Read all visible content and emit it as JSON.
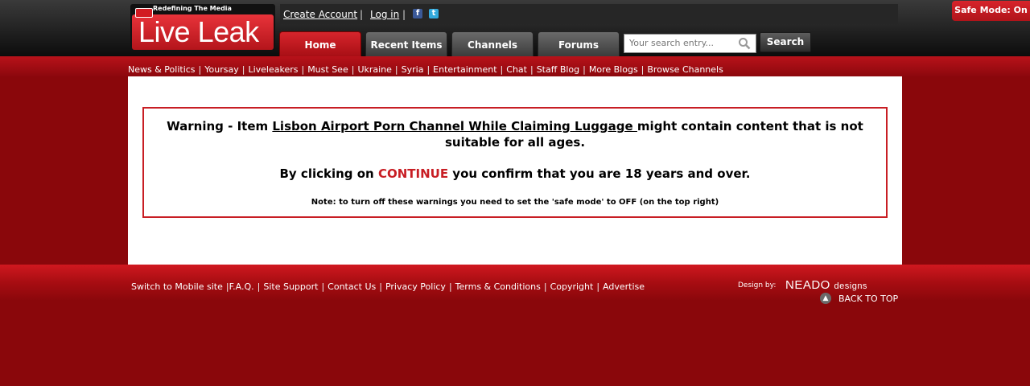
{
  "header": {
    "logo_tagline": "Redefining The Media",
    "logo_word_1": "Live",
    "logo_word_2": "Leak",
    "create_account": "Create Account",
    "log_in": "Log in",
    "separator": "|",
    "tabs": [
      {
        "label": "Home",
        "active": true
      },
      {
        "label": "Recent Items",
        "active": false
      },
      {
        "label": "Channels",
        "active": false
      },
      {
        "label": "Forums",
        "active": false
      }
    ],
    "search": {
      "placeholder": "Your search entry...",
      "button_label": "Search"
    },
    "safe_mode": "Safe Mode: On",
    "icons": [
      "facebook-icon",
      "twitter-icon",
      "search-icon"
    ]
  },
  "subnav": {
    "items": [
      "News & Politics",
      "Yoursay",
      "Liveleakers",
      "Must See",
      "Ukraine",
      "Syria",
      "Entertainment",
      "Chat",
      "Staff Blog",
      "More Blogs",
      "Browse Channels"
    ]
  },
  "warning": {
    "prefix": "Warning - Item ",
    "item_title": "Lisbon Airport Porn Channel While Claiming Luggage ",
    "suffix": "might contain content that is not suitable for all ages.",
    "confirm_prefix": "By clicking on ",
    "continue_label": "CONTINUE",
    "confirm_suffix": " you confirm that you are 18 years and over.",
    "note": "Note: to turn off these warnings you need to set the 'safe mode' to OFF (on the top right)"
  },
  "footer": {
    "links": [
      "Switch to Mobile site",
      "F.A.Q.",
      "Site Support",
      "Contact Us",
      "Privacy Policy",
      "Terms & Conditions",
      "Copyright",
      "Advertise"
    ],
    "design_by": "Design by:",
    "designer_name": "NEADO",
    "designer_suffix": "designs",
    "back_to_top": "BACK TO TOP"
  },
  "colors": {
    "brand_red": "#c81e24",
    "page_bg": "#8a070b"
  }
}
